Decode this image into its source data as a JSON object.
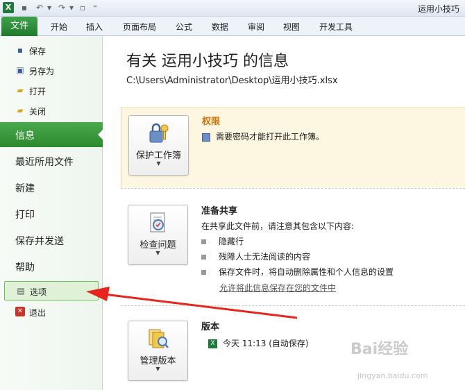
{
  "window": {
    "title": "运用小技巧"
  },
  "ribbon": {
    "file_tab": "文件",
    "tabs": [
      "开始",
      "插入",
      "页面布局",
      "公式",
      "数据",
      "审阅",
      "视图",
      "开发工具"
    ]
  },
  "nav": {
    "small_items": [
      {
        "label": "保存",
        "icon": "save-icon"
      },
      {
        "label": "另存为",
        "icon": "save-as-icon"
      },
      {
        "label": "打开",
        "icon": "open-folder-icon"
      },
      {
        "label": "关闭",
        "icon": "close-folder-icon"
      }
    ],
    "big_items": [
      "信息",
      "最近所用文件",
      "新建",
      "打印",
      "保存并发送",
      "帮助"
    ],
    "options_label": "选项",
    "exit_label": "退出"
  },
  "main": {
    "title": "有关 运用小技巧 的信息",
    "path": "C:\\Users\\Administrator\\Desktop\\运用小技巧.xlsx",
    "permissions": {
      "button_label": "保护工作簿",
      "heading": "权限",
      "text": "需要密码才能打开此工作簿。"
    },
    "prepare": {
      "button_label": "检查问题",
      "heading": "准备共享",
      "text": "在共享此文件前，请注意其包含以下内容:",
      "bullets": [
        "隐藏行",
        "残障人士无法阅读的内容",
        "保存文件时，将自动删除属性和个人信息的设置"
      ],
      "link": "允许将此信息保存在您的文件中"
    },
    "versions": {
      "button_label": "管理版本",
      "heading": "版本",
      "entry": "今天 11:13 (自动保存)"
    }
  },
  "watermark": {
    "text": "Bai经验",
    "sub": "jingyan.baidu.com"
  },
  "colors": {
    "accent_green": "#2b8a2e",
    "heading_orange": "#d86f00",
    "arrow_red": "#e8251c"
  }
}
